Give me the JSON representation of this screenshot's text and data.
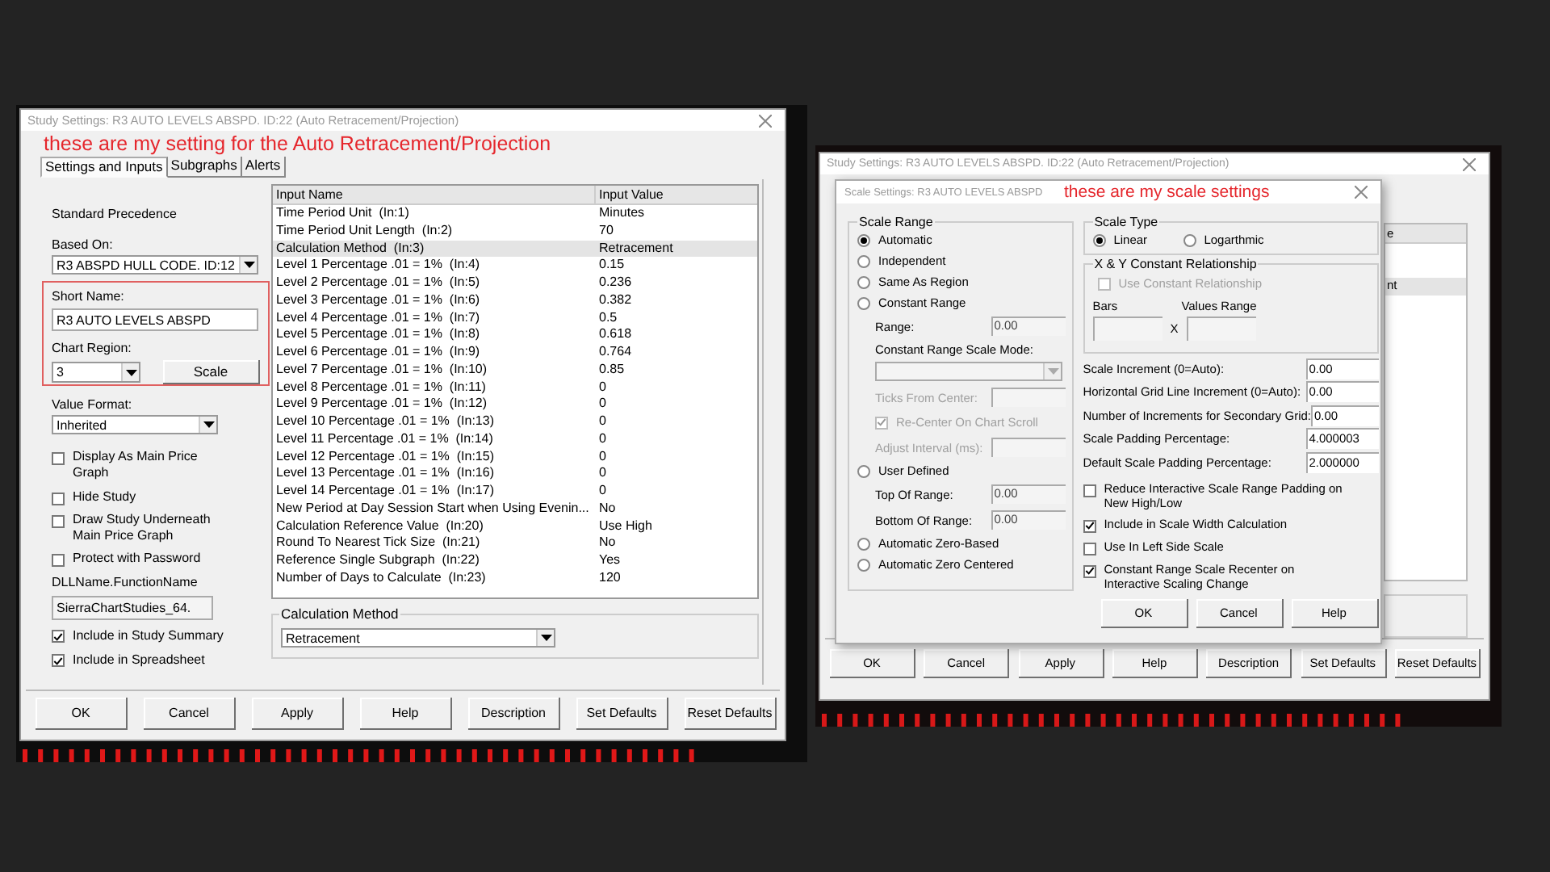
{
  "left_screenshot": {
    "window_title": "Study Settings: R3 AUTO LEVELS ABSPD. ID:22 (Auto Retracement/Projection)",
    "annotation": "these are my setting for the Auto Retracement/Projection",
    "tabs": [
      {
        "label": "Settings and Inputs",
        "selected": true
      },
      {
        "label": "Subgraphs",
        "selected": false
      },
      {
        "label": "Alerts",
        "selected": false
      }
    ],
    "standard_precedence": "Standard Precedence",
    "based_on": {
      "label": "Based On:",
      "value": "R3 ABSPD HULL CODE. ID:12"
    },
    "short_name": {
      "label": "Short Name:",
      "value": "R3 AUTO LEVELS ABSPD"
    },
    "chart_region": {
      "label": "Chart Region:",
      "value": "3"
    },
    "scale_button": "Scale",
    "value_format": {
      "label": "Value Format:",
      "value": "Inherited"
    },
    "options": [
      {
        "label": "Display As Main Price Graph",
        "checked": false
      },
      {
        "label": "Hide Study",
        "checked": false
      },
      {
        "label": "Draw Study Underneath Main Price Graph",
        "checked": false
      },
      {
        "label": "Protect with Password",
        "checked": false
      }
    ],
    "dll": {
      "label": "DLLName.FunctionName",
      "value": "SierraChartStudies_64."
    },
    "include_options": [
      {
        "label": "Include in Study Summary",
        "checked": true
      },
      {
        "label": "Include in Spreadsheet",
        "checked": true
      }
    ],
    "inputs_table": {
      "columns": [
        "Input Name",
        "Input Value"
      ],
      "rows": [
        {
          "name": "Time Period Unit  (In:1)",
          "value": "Minutes",
          "selected": false
        },
        {
          "name": "Time Period Unit Length  (In:2)",
          "value": "70",
          "selected": false
        },
        {
          "name": "Calculation Method  (In:3)",
          "value": "Retracement",
          "selected": true
        },
        {
          "name": "Level 1 Percentage .01 = 1%  (In:4)",
          "value": "0.15",
          "selected": false
        },
        {
          "name": "Level 2 Percentage .01 = 1%  (In:5)",
          "value": "0.236",
          "selected": false
        },
        {
          "name": "Level 3 Percentage .01 = 1%  (In:6)",
          "value": "0.382",
          "selected": false
        },
        {
          "name": "Level 4 Percentage .01 = 1%  (In:7)",
          "value": "0.5",
          "selected": false
        },
        {
          "name": "Level 5 Percentage .01 = 1%  (In:8)",
          "value": "0.618",
          "selected": false
        },
        {
          "name": "Level 6 Percentage .01 = 1%  (In:9)",
          "value": "0.764",
          "selected": false
        },
        {
          "name": "Level 7 Percentage .01 = 1%  (In:10)",
          "value": "0.85",
          "selected": false
        },
        {
          "name": "Level 8 Percentage .01 = 1%  (In:11)",
          "value": "0",
          "selected": false
        },
        {
          "name": "Level 9 Percentage .01 = 1%  (In:12)",
          "value": "0",
          "selected": false
        },
        {
          "name": "Level 10 Percentage .01 = 1%  (In:13)",
          "value": "0",
          "selected": false
        },
        {
          "name": "Level 11 Percentage .01 = 1%  (In:14)",
          "value": "0",
          "selected": false
        },
        {
          "name": "Level 12 Percentage .01 = 1%  (In:15)",
          "value": "0",
          "selected": false
        },
        {
          "name": "Level 13 Percentage .01 = 1%  (In:16)",
          "value": "0",
          "selected": false
        },
        {
          "name": "Level 14 Percentage .01 = 1%  (In:17)",
          "value": "0",
          "selected": false
        },
        {
          "name": "New Period at Day Session Start when Using Evenin...",
          "value": "No",
          "selected": false
        },
        {
          "name": "Calculation Reference Value  (In:20)",
          "value": "Use High",
          "selected": false
        },
        {
          "name": "Round To Nearest Tick Size  (In:21)",
          "value": "No",
          "selected": false
        },
        {
          "name": "Reference Single Subgraph  (In:22)",
          "value": "Yes",
          "selected": false
        },
        {
          "name": "Number of Days to Calculate  (In:23)",
          "value": "120",
          "selected": false
        }
      ]
    },
    "calculation_method": {
      "label": "Calculation Method",
      "value": "Retracement"
    },
    "buttons": [
      "OK",
      "Cancel",
      "Apply",
      "Help",
      "Description",
      "Set Defaults",
      "Reset Defaults"
    ]
  },
  "right_screenshot": {
    "back_window_title": "Study Settings: R3 AUTO LEVELS ABSPD. ID:22 (Auto Retracement/Projection)",
    "back_table": {
      "header_fragment": "e",
      "rows": [
        {
          "text": "nt",
          "selected": true
        }
      ]
    },
    "back_buttons": [
      "OK",
      "Cancel",
      "Apply",
      "Help",
      "Description",
      "Set Defaults",
      "Reset Defaults"
    ],
    "scale_dialog": {
      "title": "Scale Settings: R3 AUTO LEVELS ABSPD",
      "annotation": "these are my scale settings",
      "scale_range": {
        "legend": "Scale Range",
        "items": [
          {
            "kind": "radio",
            "label": "Automatic",
            "selected": true
          },
          {
            "kind": "radio",
            "label": "Independent",
            "selected": false
          },
          {
            "kind": "radio",
            "label": "Same As Region",
            "selected": false
          },
          {
            "kind": "radio",
            "label": "Constant Range",
            "selected": false
          },
          {
            "kind": "field",
            "label": "Range:",
            "value": "0.00",
            "disabled": false
          },
          {
            "kind": "dropdown",
            "label": "Constant Range Scale Mode:",
            "disabled": true
          },
          {
            "kind": "field",
            "label": "Ticks From Center:",
            "disabled": true
          },
          {
            "kind": "checkbox",
            "label": "Re-Center On Chart Scroll",
            "checked": true,
            "disabled": true
          },
          {
            "kind": "field",
            "label": "Adjust Interval (ms):",
            "disabled": true
          },
          {
            "kind": "radio",
            "label": "User Defined",
            "selected": false
          },
          {
            "kind": "field",
            "label": "Top Of Range:",
            "value": "0.00",
            "disabled": false
          },
          {
            "kind": "field",
            "label": "Bottom Of Range:",
            "value": "0.00",
            "disabled": false
          },
          {
            "kind": "radio",
            "label": "Automatic Zero-Based",
            "selected": false
          },
          {
            "kind": "radio",
            "label": "Automatic Zero Centered",
            "selected": false
          }
        ]
      },
      "scale_type": {
        "legend": "Scale Type",
        "options": [
          {
            "label": "Linear",
            "selected": true
          },
          {
            "label": "Logarthmic",
            "selected": false
          }
        ]
      },
      "xy_relationship": {
        "legend": "X & Y Constant Relationship",
        "checkbox": {
          "label": "Use Constant Relationship",
          "checked": false,
          "disabled": true
        },
        "bars_label": "Bars",
        "values_label": "Values Range",
        "separator": "X"
      },
      "fields": [
        {
          "label": "Scale Increment (0=Auto):",
          "value": "0.00"
        },
        {
          "label": "Horizontal Grid Line Increment (0=Auto):",
          "value": "0.00"
        },
        {
          "label": "Number of Increments for Secondary Grid:",
          "value": "0.00"
        },
        {
          "label": "Scale Padding Percentage:",
          "value": "4.000003"
        },
        {
          "label": "Default Scale Padding Percentage:",
          "value": "2.000000"
        }
      ],
      "options": [
        {
          "label": "Reduce Interactive Scale Range Padding on New High/Low",
          "checked": false
        },
        {
          "label": "Include in Scale Width Calculation",
          "checked": true
        },
        {
          "label": "Use In Left Side Scale",
          "checked": false
        },
        {
          "label": "Constant Range Scale Recenter on Interactive Scaling Change",
          "checked": true
        }
      ],
      "buttons": [
        "OK",
        "Cancel",
        "Help"
      ]
    }
  }
}
